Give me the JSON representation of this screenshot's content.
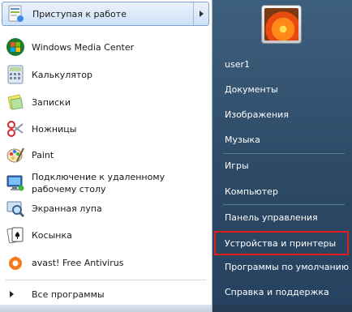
{
  "left": {
    "pinned": {
      "label": "Приступая к работе",
      "icon": "getting-started-icon"
    },
    "programs": [
      {
        "label": "Windows Media Center",
        "icon": "windows-media-center-icon"
      },
      {
        "label": "Калькулятор",
        "icon": "calculator-icon"
      },
      {
        "label": "Записки",
        "icon": "sticky-notes-icon"
      },
      {
        "label": "Ножницы",
        "icon": "scissors-icon"
      },
      {
        "label": "Paint",
        "icon": "paint-icon"
      },
      {
        "label": "Подключение к удаленному рабочему столу",
        "icon": "remote-desktop-icon"
      },
      {
        "label": "Экранная лупа",
        "icon": "magnifier-icon"
      },
      {
        "label": "Косынка",
        "icon": "solitaire-icon"
      },
      {
        "label": "avast! Free Antivirus",
        "icon": "avast-icon"
      }
    ],
    "all_programs": "Все программы"
  },
  "right": {
    "items": [
      {
        "label": "user1"
      },
      {
        "label": "Документы"
      },
      {
        "label": "Изображения"
      },
      {
        "label": "Музыка"
      },
      {
        "label": "Игры"
      },
      {
        "label": "Компьютер"
      },
      {
        "label": "Панель управления"
      },
      {
        "label": "Устройства и принтеры"
      },
      {
        "label": "Программы по умолчанию"
      },
      {
        "label": "Справка и поддержка"
      }
    ]
  },
  "colors": {
    "highlight_border": "#e21b1b",
    "right_panel": "#2b4864"
  }
}
